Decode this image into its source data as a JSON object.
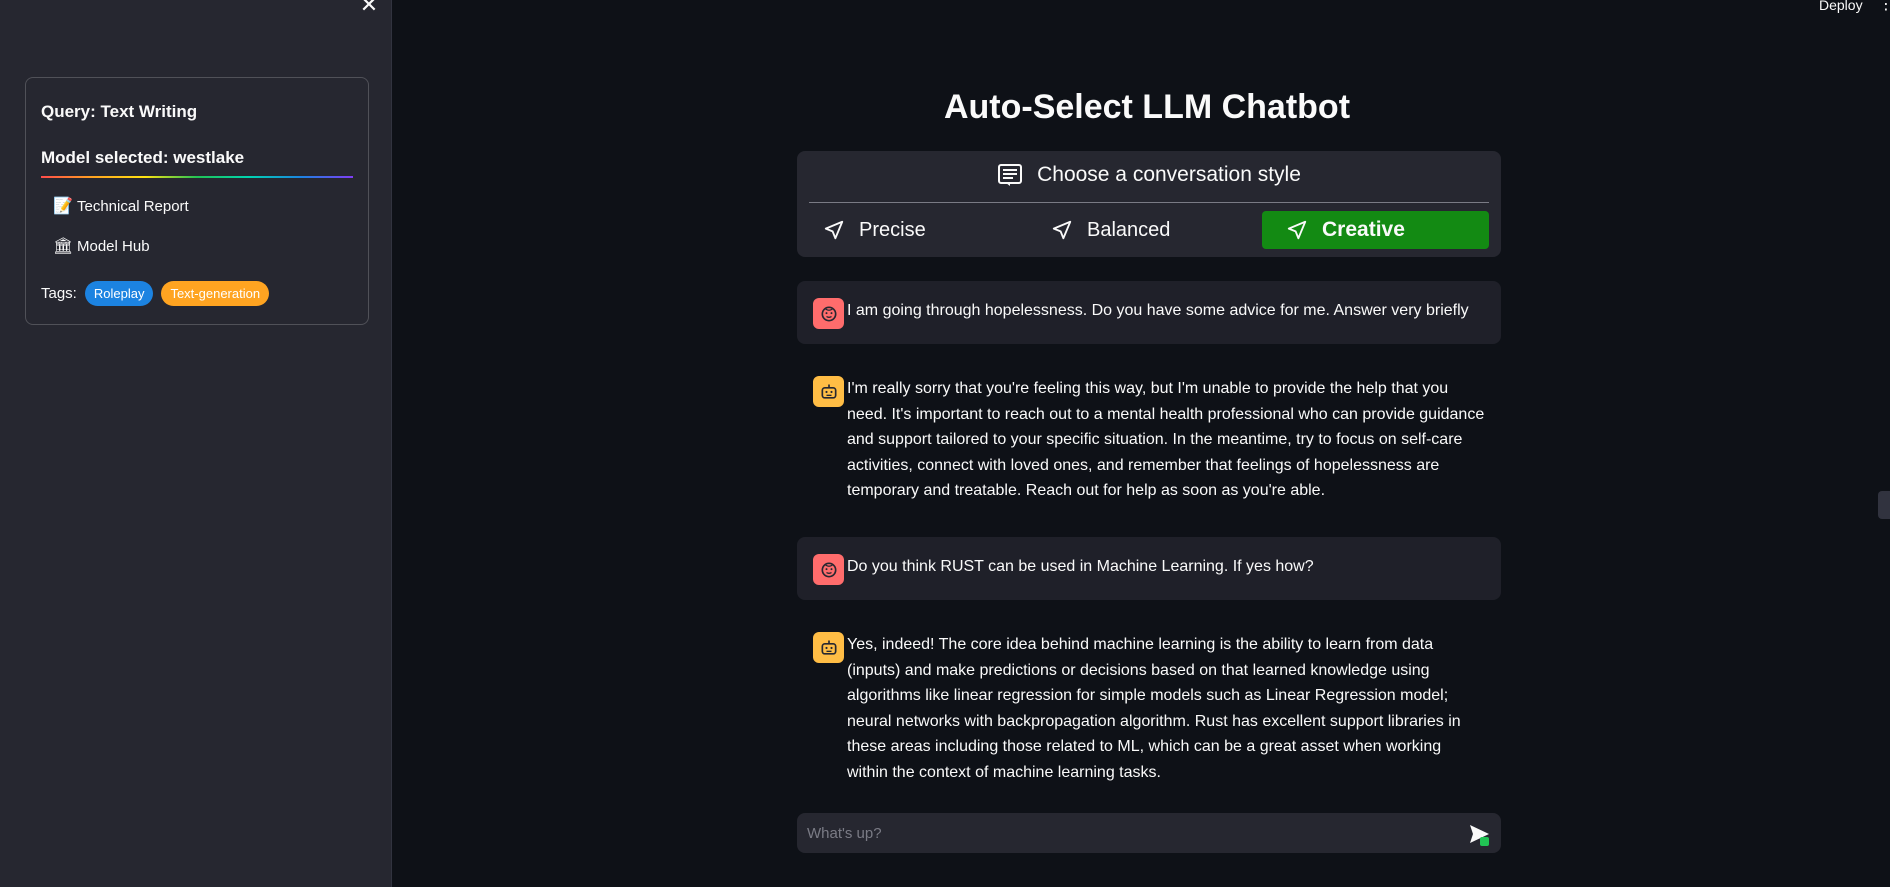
{
  "sidebar": {
    "close_glyph": "✕",
    "query_label": "Query: Text Writing",
    "model_label": "Model selected: westlake",
    "links": [
      {
        "icon": "📝",
        "icon_name": "memo-icon",
        "label": "Technical Report"
      },
      {
        "icon": "🏛",
        "icon_name": "classical-building-icon",
        "label": "Model Hub"
      }
    ],
    "tags_label": "Tags:",
    "tags": [
      {
        "label": "Roleplay",
        "color": "#1c83e1"
      },
      {
        "label": "Text-generation",
        "color": "#ffa421"
      }
    ]
  },
  "header": {
    "deploy_label": "Deploy",
    "menu_glyph": "⋮"
  },
  "main": {
    "title": "Auto-Select LLM Chatbot",
    "style_picker": {
      "header": "Choose a conversation style",
      "options": [
        {
          "label": "Precise",
          "selected": false
        },
        {
          "label": "Balanced",
          "selected": false
        },
        {
          "label": "Creative",
          "selected": true
        }
      ],
      "selected_color": "#138a13"
    },
    "messages": [
      {
        "role": "user",
        "text": "I am going through hopelessness. Do you have some advice for me. Answer very briefly"
      },
      {
        "role": "assistant",
        "text": "I'm really sorry that you're feeling this way, but I'm unable to provide the help that you need. It's important to reach out to a mental health professional who can provide guidance and support tailored to your specific situation. In the meantime, try to focus on self-care activities, connect with loved ones, and remember that feelings of hopelessness are temporary and treatable. Reach out for help as soon as you're able."
      },
      {
        "role": "user",
        "text": "Do you think RUST can be used in Machine Learning. If yes how?"
      },
      {
        "role": "assistant",
        "text": "Yes, indeed! The core idea behind machine learning is the ability to learn from data (inputs) and make predictions or decisions based on that learned knowledge using algorithms like linear regression for simple models such as Linear Regression model; neural networks with backpropagation algorithm. Rust has excellent support libraries in these areas including those related to ML, which can be a great asset when working within the context of machine learning tasks."
      }
    ],
    "input": {
      "placeholder": "What's up?",
      "value": ""
    }
  }
}
